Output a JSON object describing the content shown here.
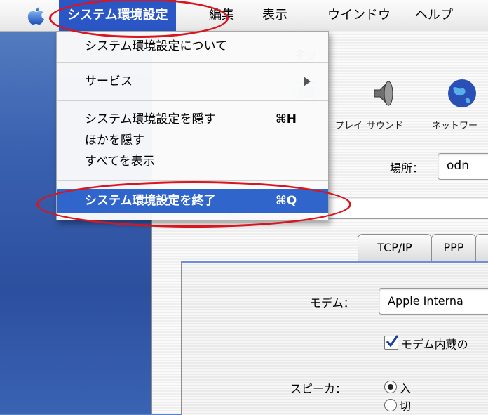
{
  "menubar": {
    "app_menu": "システム環境設定",
    "items": [
      "編集",
      "表示",
      "ウインドウ",
      "ヘルプ"
    ]
  },
  "dropdown": {
    "about": "システム環境設定について",
    "services": "サービス",
    "hide": "システム環境設定を隠す",
    "hide_shortcut": "⌘H",
    "hide_others": "ほかを隠す",
    "show_all": "すべてを表示",
    "quit": "システム環境設定を終了",
    "quit_shortcut": "⌘Q"
  },
  "window": {
    "title_partial": "ネッ",
    "toolbar": {
      "display_partial": "プレイ",
      "sound": "サウンド",
      "network_partial": "ネットワー"
    },
    "location_label": "場所：",
    "location_value": "odn",
    "tabs": [
      "TCP/IP",
      "PPP"
    ],
    "modem_label": "モデム：",
    "modem_value": "Apple Interna",
    "checkbox_label": "モデム内蔵の",
    "speaker_label": "スピーカ：",
    "speaker_on": "入",
    "speaker_off": "切"
  },
  "colors": {
    "highlight": "#3065cb",
    "annotation": "#d8161f"
  }
}
